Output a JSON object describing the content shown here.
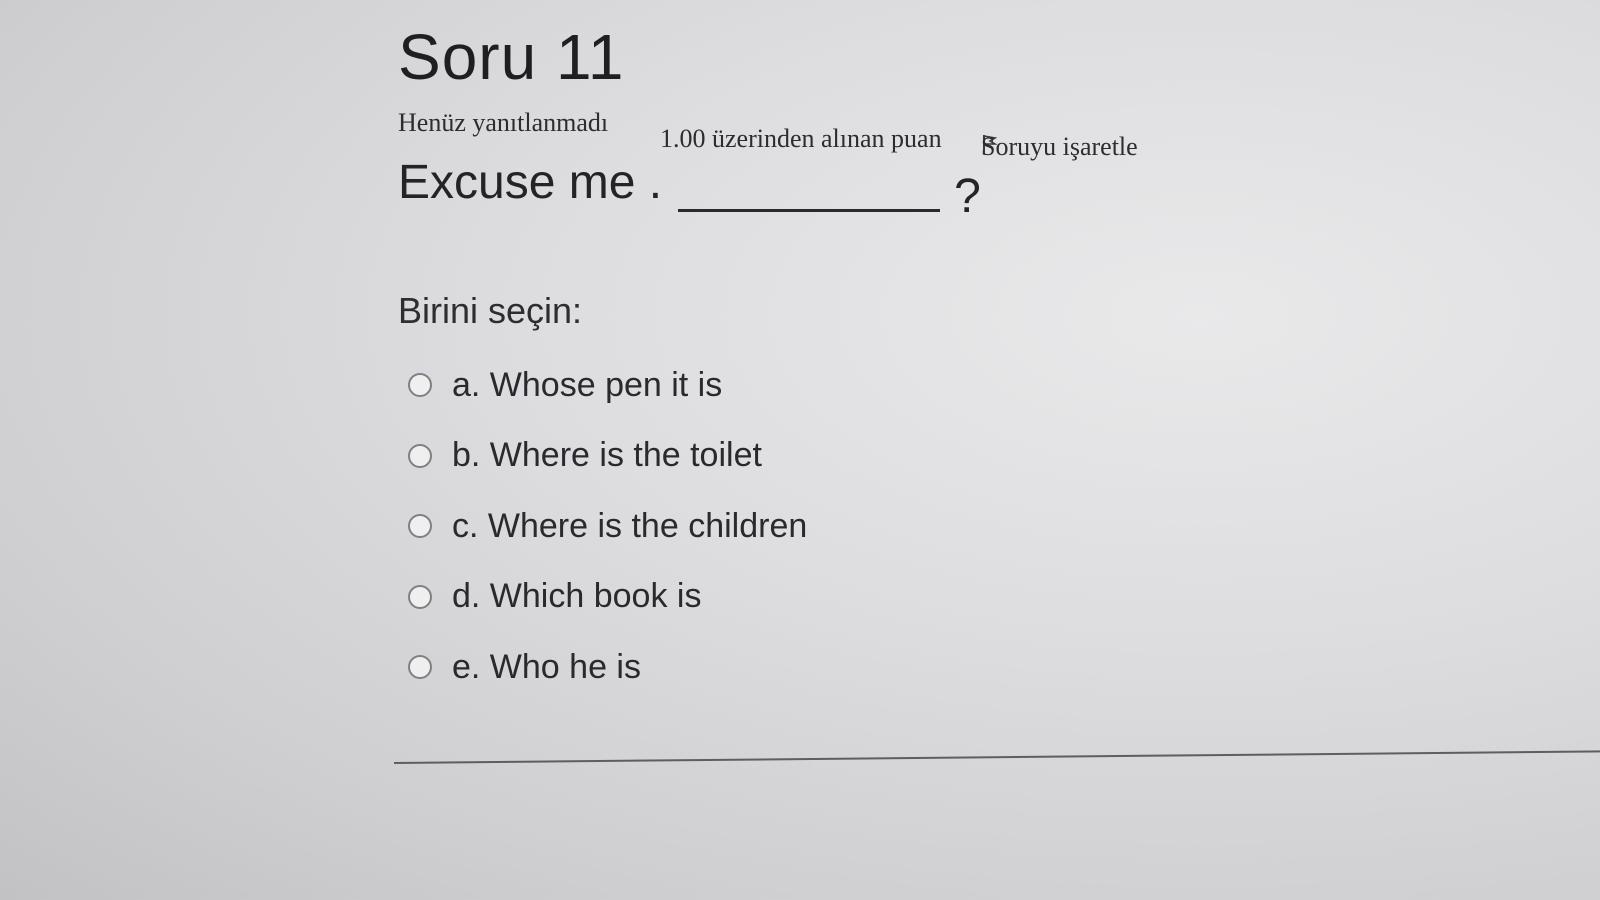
{
  "question": {
    "title": "Soru 11",
    "status": "Henüz yanıtlanmadı",
    "score_label": "1.00 üzerinden alınan puan",
    "flag_label": "Soruyu işaretle",
    "flag_icon": "flag-icon",
    "text_before_blank": "Excuse me .",
    "text_after_blank": "?"
  },
  "answer": {
    "prompt": "Birini seçin:",
    "options": [
      {
        "label": "a. Whose pen it is",
        "selected": false
      },
      {
        "label": "b. Where is the toilet",
        "selected": false
      },
      {
        "label": "c. Where is the children",
        "selected": false
      },
      {
        "label": "d. Which book is",
        "selected": false
      },
      {
        "label": "e. Who he is",
        "selected": false
      }
    ]
  }
}
